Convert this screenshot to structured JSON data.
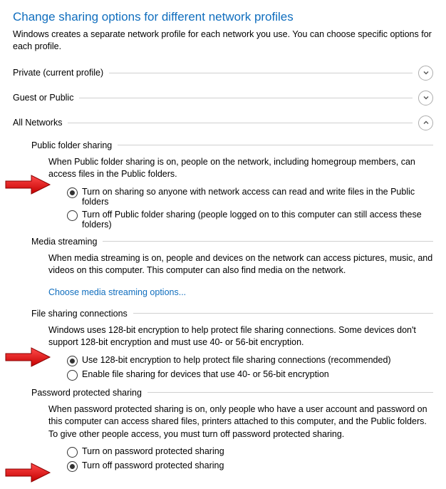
{
  "page": {
    "title": "Change sharing options for different network profiles",
    "subtitle": "Windows creates a separate network profile for each network you use. You can choose specific options for each profile."
  },
  "profiles": {
    "private": "Private (current profile)",
    "guest": "Guest or Public",
    "all": "All Networks"
  },
  "public_folder_sharing": {
    "heading": "Public folder sharing",
    "desc": "When Public folder sharing is on, people on the network, including homegroup members, can access files in the Public folders.",
    "opt_on": "Turn on sharing so anyone with network access can read and write files in the Public folders",
    "opt_off": "Turn off Public folder sharing (people logged on to this computer can still access these folders)"
  },
  "media_streaming": {
    "heading": "Media streaming",
    "desc": "When media streaming is on, people and devices on the network can access pictures, music, and videos on this computer. This computer can also find media on the network.",
    "link": "Choose media streaming options..."
  },
  "file_sharing": {
    "heading": "File sharing connections",
    "desc": "Windows uses 128-bit encryption to help protect file sharing connections. Some devices don't support 128-bit encryption and must use 40- or 56-bit encryption.",
    "opt_128": "Use 128-bit encryption to help protect file sharing connections (recommended)",
    "opt_40": "Enable file sharing for devices that use 40- or 56-bit encryption"
  },
  "password_sharing": {
    "heading": "Password protected sharing",
    "desc": "When password protected sharing is on, only people who have a user account and password on this computer can access shared files, printers attached to this computer, and the Public folders. To give other people access, you must turn off password protected sharing.",
    "opt_on": "Turn on password protected sharing",
    "opt_off": "Turn off password protected sharing"
  }
}
